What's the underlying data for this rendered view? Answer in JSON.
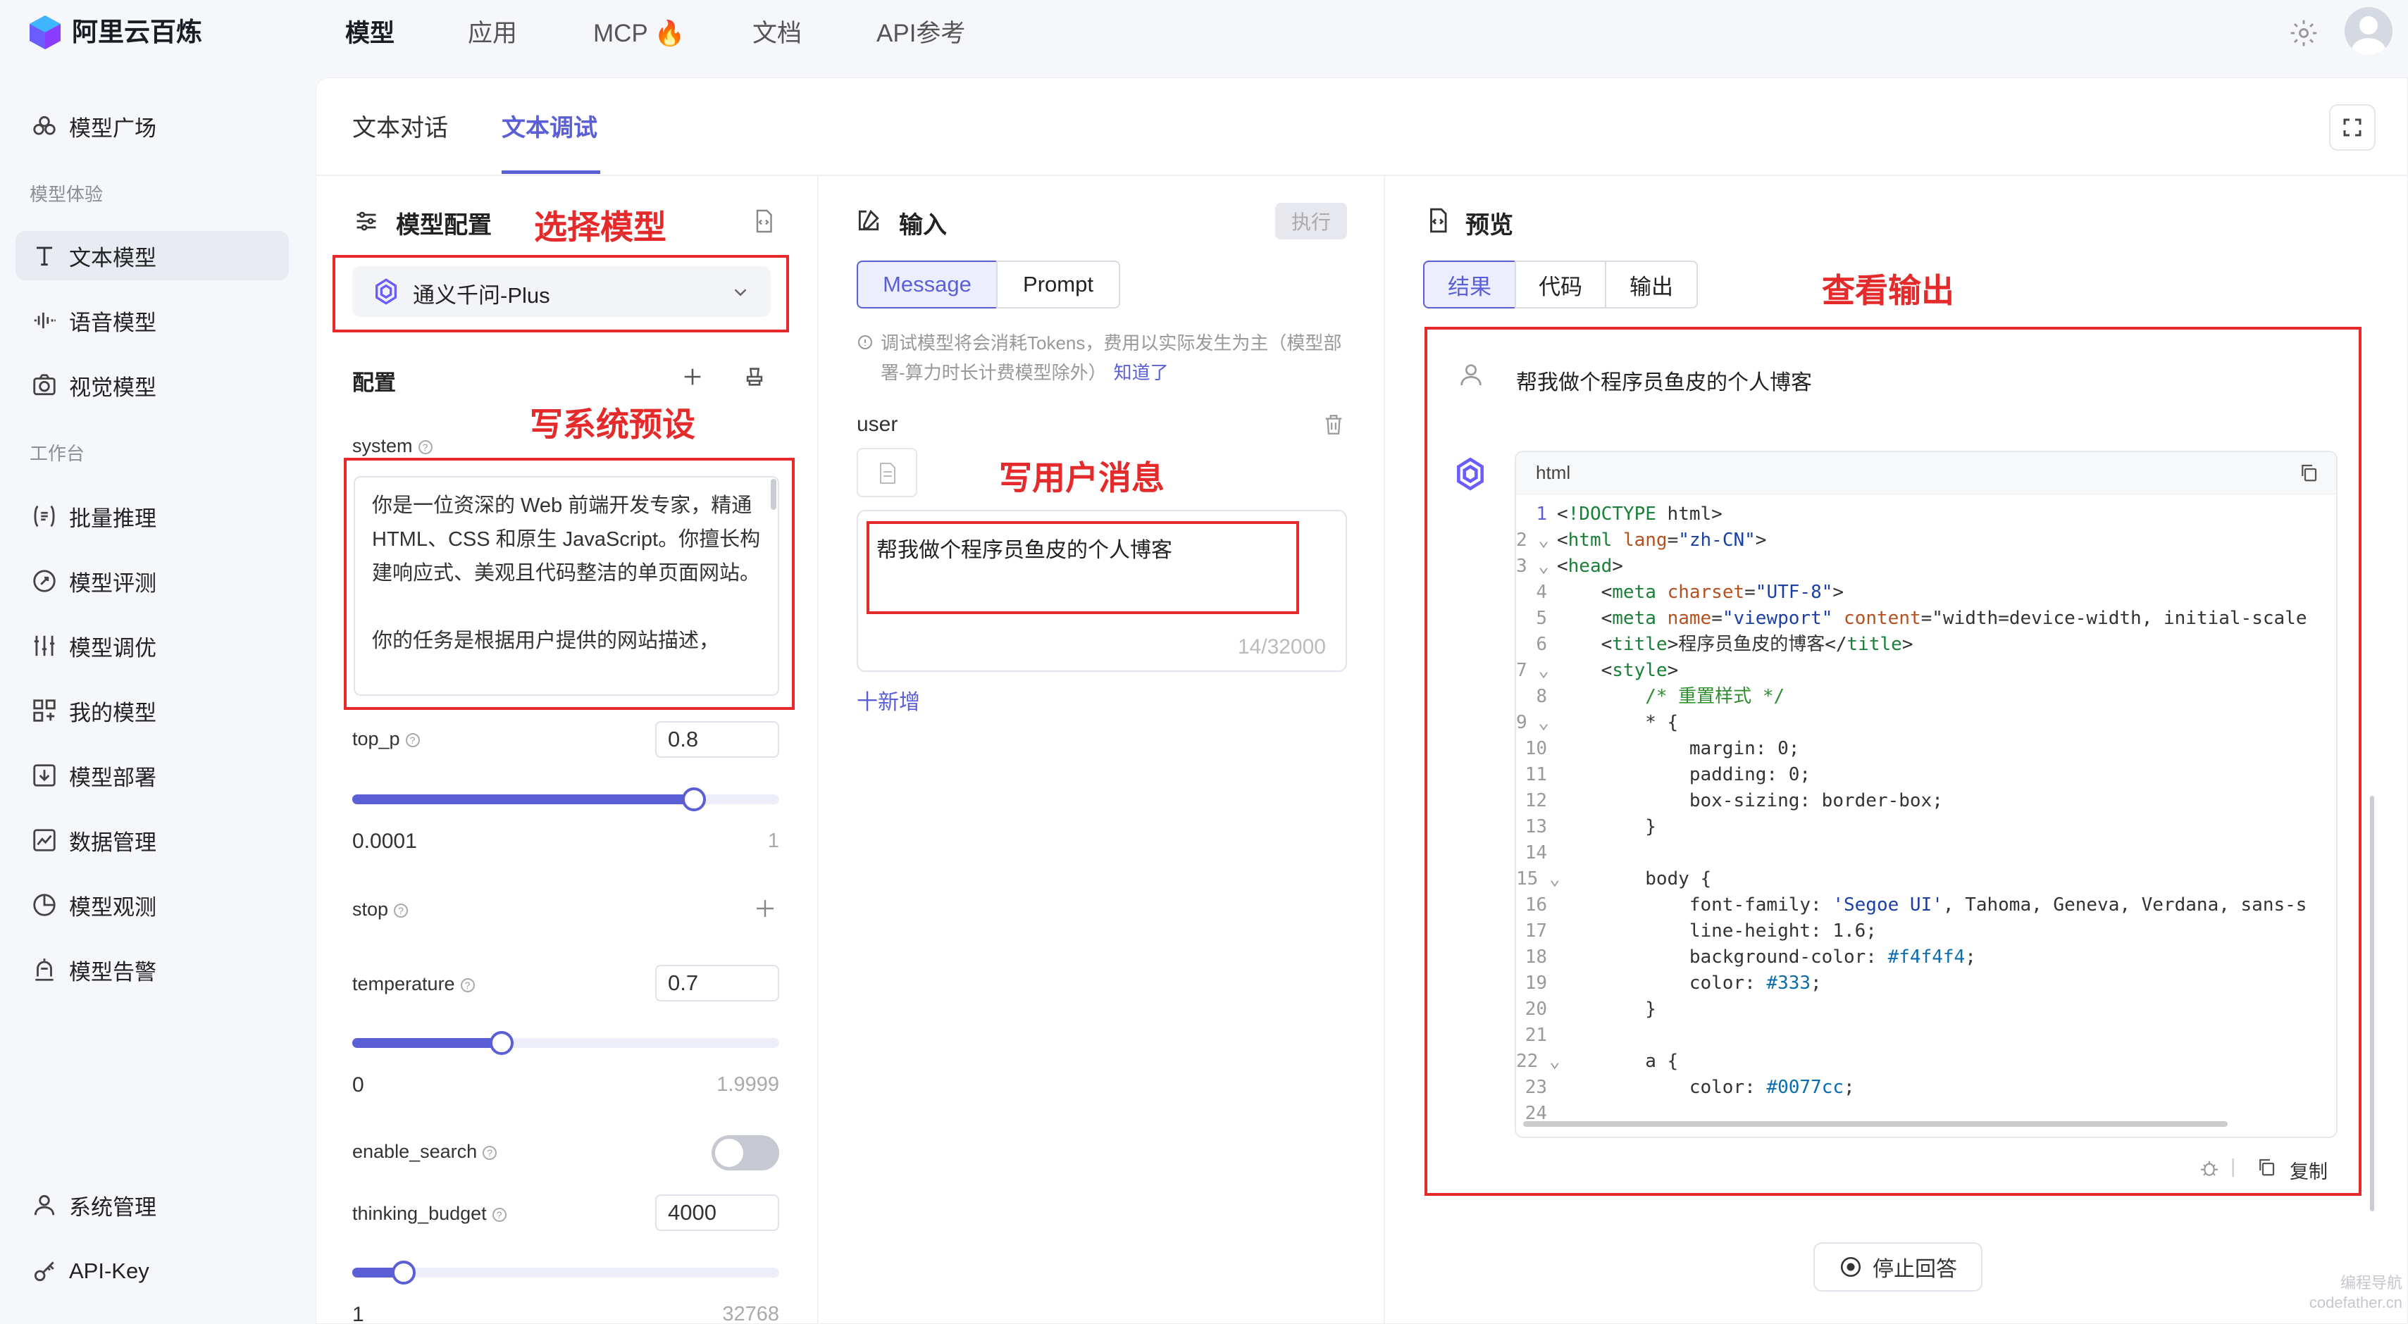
{
  "app": {
    "brand": "阿里云百炼"
  },
  "topnav": {
    "items": [
      "模型",
      "应用",
      "MCP 🔥",
      "文档",
      "API参考"
    ]
  },
  "sidebar": {
    "items": [
      {
        "label": "模型广场",
        "icon": "plaza-icon"
      },
      {
        "label": "文本模型",
        "icon": "text-icon",
        "active": true
      },
      {
        "label": "语音模型",
        "icon": "audio-wave-icon"
      },
      {
        "label": "视觉模型",
        "icon": "camera-icon"
      },
      {
        "label": "批量推理",
        "icon": "batch-icon"
      },
      {
        "label": "模型评测",
        "icon": "target-icon"
      },
      {
        "label": "模型调优",
        "icon": "sliders-icon"
      },
      {
        "label": "我的模型",
        "icon": "grid-icon"
      },
      {
        "label": "模型部署",
        "icon": "deploy-icon"
      },
      {
        "label": "数据管理",
        "icon": "chart-line-icon"
      },
      {
        "label": "模型观测",
        "icon": "pie-icon"
      },
      {
        "label": "模型告警",
        "icon": "alarm-icon"
      },
      {
        "label": "系统管理",
        "icon": "user-icon"
      },
      {
        "label": "API-Key",
        "icon": "key-icon"
      }
    ],
    "groups": [
      "模型体验",
      "工作台"
    ]
  },
  "tabs": [
    {
      "label": "文本对话"
    },
    {
      "label": "文本调试",
      "active": true
    }
  ],
  "config": {
    "title": "模型配置",
    "annotation_select": "选择模型",
    "model": "通义千问-Plus",
    "section": "配置",
    "annotation_system": "写系统预设",
    "system_label": "system",
    "system_text": "你是一位资深的 Web 前端开发专家，精通 HTML、CSS 和原生 JavaScript。你擅长构建响应式、美观且代码整洁的单页面网站。\n\n你的任务是根据用户提供的网站描述，",
    "params": [
      {
        "name": "top_p",
        "value": "0.8",
        "min": "0.0001",
        "max": "1",
        "fraction": 0.8
      },
      {
        "name": "stop"
      },
      {
        "name": "temperature",
        "value": "0.7",
        "min": "0",
        "max": "1.9999",
        "fraction": 0.35
      },
      {
        "name": "enable_search",
        "toggle": false
      },
      {
        "name": "thinking_budget",
        "value": "4000",
        "min": "1",
        "max": "32768",
        "fraction": 0.12
      }
    ]
  },
  "input": {
    "title": "输入",
    "run_button": "执行",
    "modes": [
      "Message",
      "Prompt"
    ],
    "notice": "调试模型将会消耗Tokens，费用以实际发生为主（模型部署-算力时长计费模型除外）",
    "notice_link": "知道了",
    "role": "user",
    "annotation": "写用户消息",
    "message": "帮我做个程序员鱼皮的个人博客",
    "counter": "14/32000",
    "add": "十新增"
  },
  "preview": {
    "title": "预览",
    "tabs": [
      "结果",
      "代码",
      "输出"
    ],
    "annotation": "查看输出",
    "user_message": "帮我做个程序员鱼皮的个人博客",
    "code_lang": "html",
    "copy_label": "复制",
    "stop_label": "停止回答",
    "code_lines": [
      "<!DOCTYPE html>",
      "<html lang=\"zh-CN\">",
      "<head>",
      "    <meta charset=\"UTF-8\">",
      "    <meta name=\"viewport\" content=\"width=device-width, initial-scale",
      "    <title>程序员鱼皮的博客</title>",
      "    <style>",
      "        /* 重置样式 */",
      "        * {",
      "            margin: 0;",
      "            padding: 0;",
      "            box-sizing: border-box;",
      "        }",
      "",
      "        body {",
      "            font-family: 'Segoe UI', Tahoma, Geneva, Verdana, sans-s",
      "            line-height: 1.6;",
      "            background-color: #f4f4f4;",
      "            color: #333;",
      "        }",
      "",
      "        a {",
      "            color: #0077cc;",
      ""
    ]
  },
  "watermark": {
    "line1": "编程导航",
    "line2": "codefather.cn"
  },
  "colors": {
    "accent": "#5b5fd6",
    "annotation": "#e42a2a"
  }
}
